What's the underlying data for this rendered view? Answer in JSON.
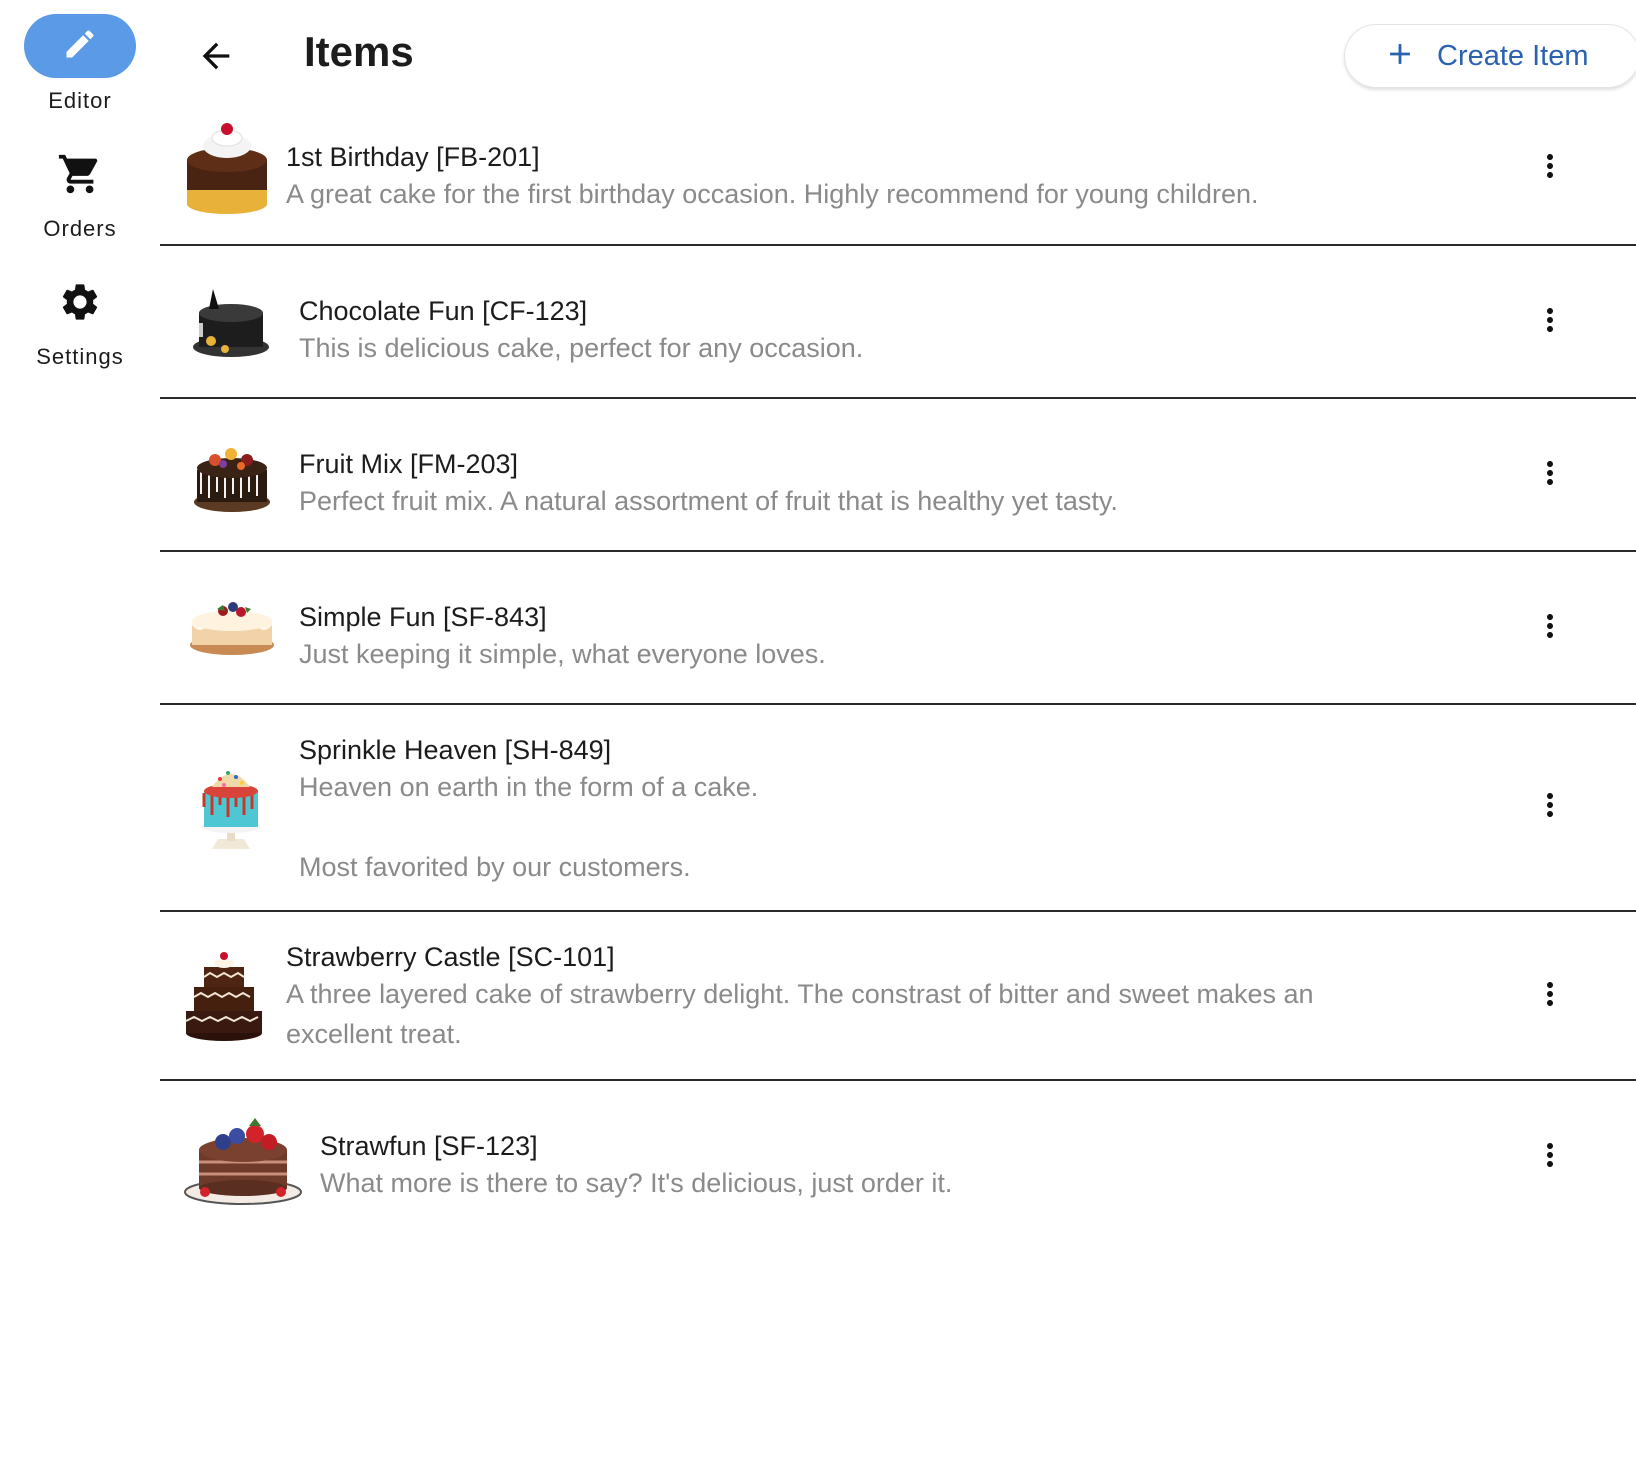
{
  "nav_rail": {
    "items": [
      {
        "label": "Editor",
        "icon": "pencil-icon",
        "active": true
      },
      {
        "label": "Orders",
        "icon": "cart-icon",
        "active": false
      },
      {
        "label": "Settings",
        "icon": "gear-icon",
        "active": false
      }
    ],
    "active_color": "#5b9ae6"
  },
  "header": {
    "back_icon": "arrow-left-icon",
    "title": "Items",
    "create_button": {
      "label": "Create Item",
      "icon": "plus-icon",
      "color": "#2a62b0"
    }
  },
  "items": [
    {
      "title": "1st Birthday [FB-201]",
      "description": "A great cake for the first birthday occasion. Highly recommend for young children.",
      "image": "chocolate-drip-cake-with-cherry",
      "menu_icon": "more-vert-icon"
    },
    {
      "title": "Chocolate Fun [CF-123]",
      "description": "This is delicious cake, perfect for any occasion.",
      "image": "black-chocolate-cake",
      "menu_icon": "more-vert-icon"
    },
    {
      "title": "Fruit Mix [FM-203]",
      "description": "Perfect fruit mix. A natural assortment of fruit that is healthy yet tasty.",
      "image": "fruit-topped-cake",
      "menu_icon": "more-vert-icon"
    },
    {
      "title": "Simple Fun [SF-843]",
      "description": "Just keeping it simple, what everyone loves.",
      "image": "cream-berry-cake",
      "menu_icon": "more-vert-icon"
    },
    {
      "title": "Sprinkle Heaven [SH-849]",
      "description": "Heaven on earth in the form of a cake.\n\nMost favorited by our customers.",
      "image": "blue-sprinkle-cake",
      "menu_icon": "more-vert-icon"
    },
    {
      "title": "Strawberry Castle [SC-101]",
      "description": "A three layered cake of strawberry delight. The constrast of bitter and sweet makes an excellent treat.",
      "image": "three-tier-chocolate-cake",
      "menu_icon": "more-vert-icon"
    },
    {
      "title": "Strawfun [SF-123]",
      "description": "What more is there to say? It's delicious, just order it.",
      "image": "berry-layer-cake",
      "menu_icon": "more-vert-icon"
    }
  ]
}
